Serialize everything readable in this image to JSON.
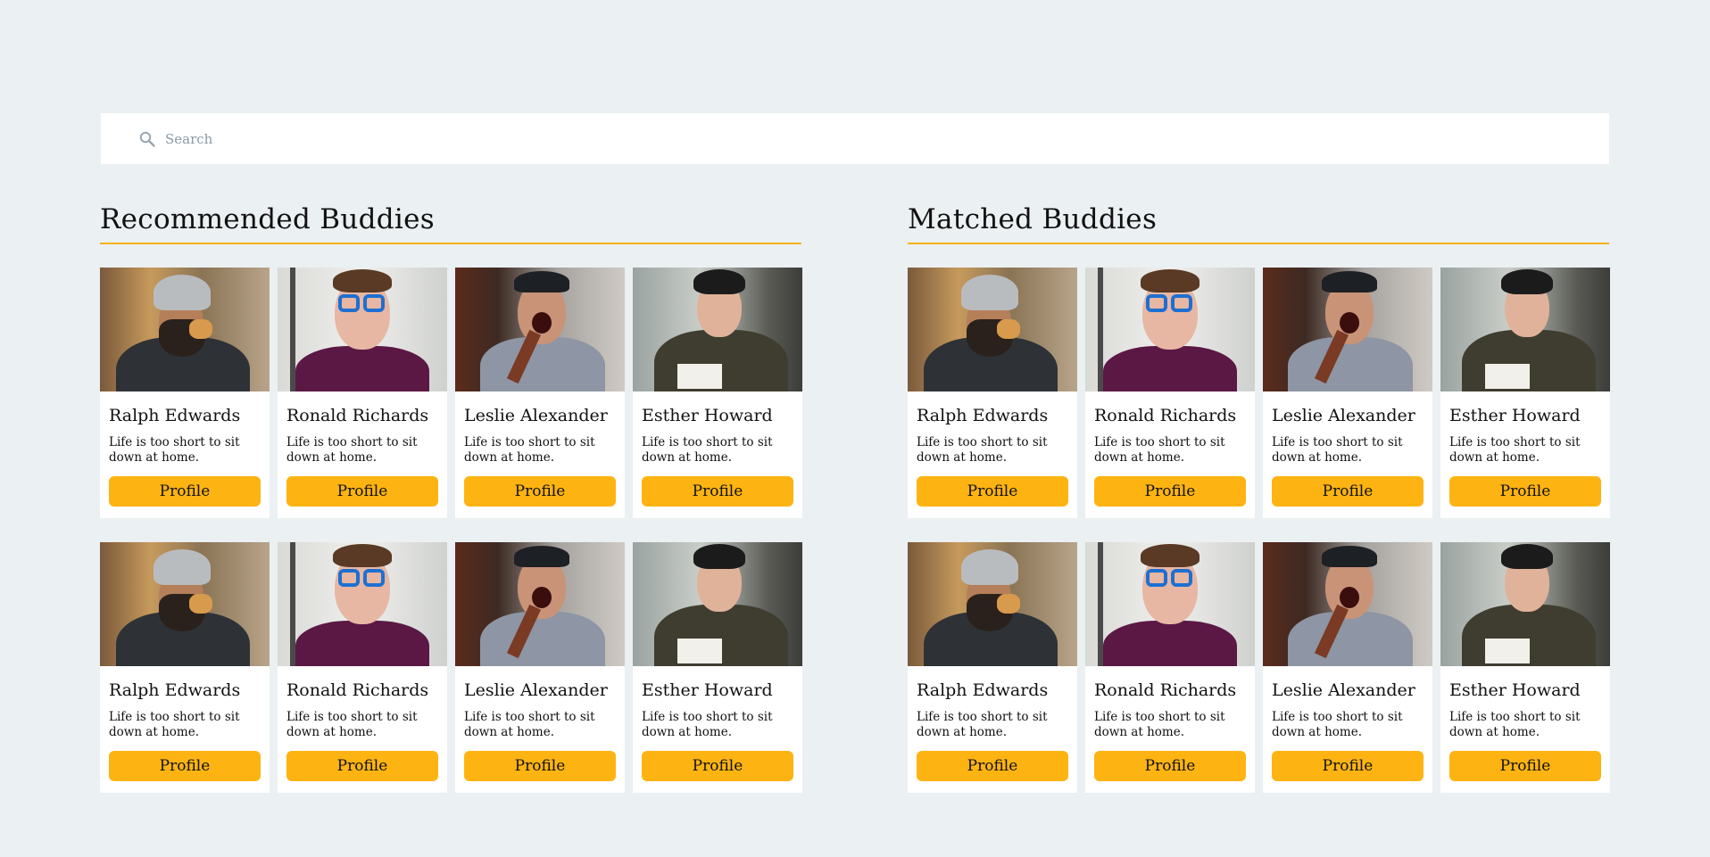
{
  "search": {
    "placeholder": "Search",
    "icon": "search-icon"
  },
  "colors": {
    "background": "#ebf0f2",
    "accent": "#fdb412",
    "rule": "#f5b119",
    "card": "#ffffff"
  },
  "sections": {
    "recommended": {
      "title": "Recommended Buddies",
      "cards": [
        {
          "name": "Ralph Edwards",
          "bio": "Life is too short to sit down at home.",
          "button": "Profile"
        },
        {
          "name": "Ronald Richards",
          "bio": "Life is too short to sit down at home.",
          "button": "Profile"
        },
        {
          "name": "Leslie Alexander",
          "bio": "Life is too short to sit down at home.",
          "button": "Profile"
        },
        {
          "name": "Esther Howard",
          "bio": "Life is too short to sit down at home.",
          "button": "Profile"
        },
        {
          "name": "Ralph Edwards",
          "bio": "Life is too short to sit down at home.",
          "button": "Profile"
        },
        {
          "name": "Ronald Richards",
          "bio": "Life is too short to sit down at home.",
          "button": "Profile"
        },
        {
          "name": "Leslie Alexander",
          "bio": "Life is too short to sit down at home.",
          "button": "Profile"
        },
        {
          "name": "Esther Howard",
          "bio": "Life is too short to sit down at home.",
          "button": "Profile"
        }
      ]
    },
    "matched": {
      "title": "Matched Buddies",
      "cards": [
        {
          "name": "Ralph Edwards",
          "bio": "Life is too short to sit down at home.",
          "button": "Profile"
        },
        {
          "name": "Ronald Richards",
          "bio": "Life is too short to sit down at home.",
          "button": "Profile"
        },
        {
          "name": "Leslie Alexander",
          "bio": "Life is too short to sit down at home.",
          "button": "Profile"
        },
        {
          "name": "Esther Howard",
          "bio": "Life is too short to sit down at home.",
          "button": "Profile"
        },
        {
          "name": "Ralph Edwards",
          "bio": "Life is too short to sit down at home.",
          "button": "Profile"
        },
        {
          "name": "Ronald Richards",
          "bio": "Life is too short to sit down at home.",
          "button": "Profile"
        },
        {
          "name": "Leslie Alexander",
          "bio": "Life is too short to sit down at home.",
          "button": "Profile"
        },
        {
          "name": "Esther Howard",
          "bio": "Life is too short to sit down at home.",
          "button": "Profile"
        }
      ]
    }
  }
}
